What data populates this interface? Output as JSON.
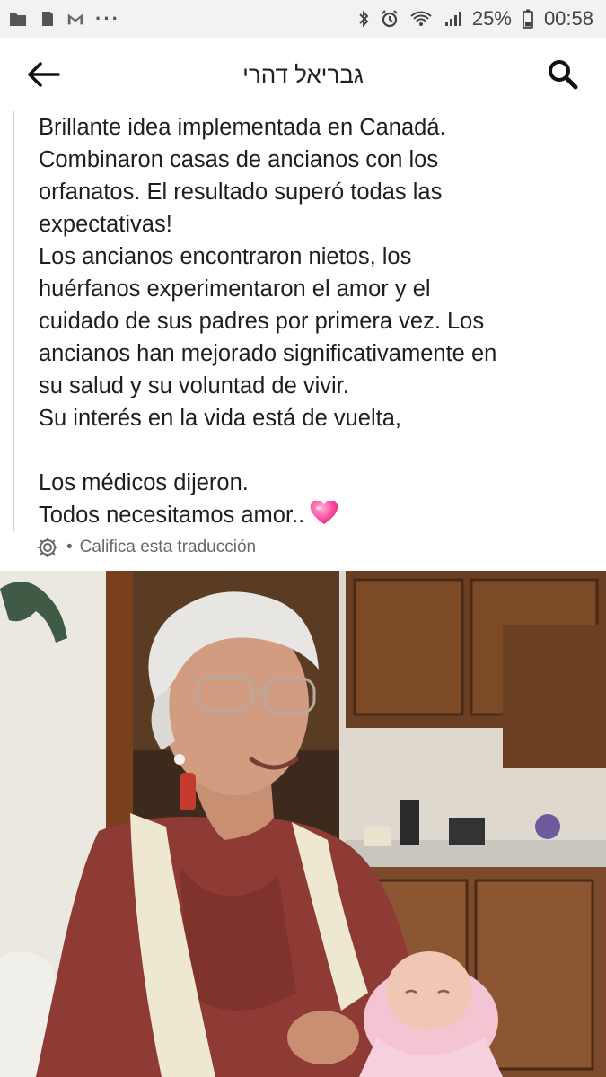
{
  "status_bar": {
    "battery": "25%",
    "time": "00:58",
    "more": "···"
  },
  "header": {
    "title": "גבריאל דהרי"
  },
  "post": {
    "text": "Brillante idea implementada en Canadá.\nCombinaron casas de ancianos con los\norfanatos. El resultado superó todas las\nexpectativas!\nLos ancianos encontraron nietos, los\nhuérfanos experimentaron el amor y el\ncuidado de sus padres por primera vez. Los\nancianos han mejorado significativamente en\nsu salud y su voluntad de vivir.\nSu interés en la vida está de vuelta,\n\nLos médicos dijeron.\nTodos necesitamos amor..",
    "translation_separator": "•",
    "rate_translation": "Califica esta traducción"
  },
  "icons": {
    "back": "arrow-left-icon",
    "search": "search-icon",
    "settings": "gear-icon",
    "heart": "pink-heart-emoji"
  },
  "colors": {
    "text": "#1c1e21",
    "secondary": "#65676b",
    "heart": "#ff4fa0"
  }
}
